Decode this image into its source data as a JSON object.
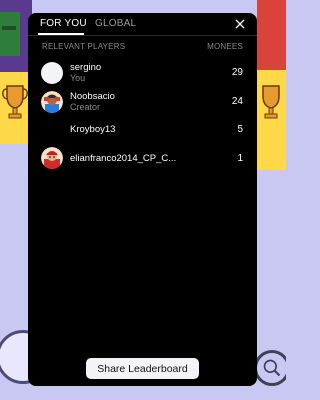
{
  "tabs": [
    {
      "label": "FOR YOU",
      "active": true
    },
    {
      "label": "GLOBAL",
      "active": false
    }
  ],
  "close_icon": "close-icon",
  "columns": {
    "players": "RELEVANT PLAYERS",
    "monees": "MONEES"
  },
  "players": [
    {
      "name": "sergino",
      "subtitle": "You",
      "score": "29",
      "avatar": "blank-avatar"
    },
    {
      "name": "Noobsacio",
      "subtitle": "Creator",
      "score": "24",
      "avatar": "character-avatar"
    },
    {
      "name": "Kroyboy13",
      "subtitle": "",
      "score": "5",
      "avatar": "none"
    },
    {
      "name": "elianfranco2014_CP_C...",
      "subtitle": "",
      "score": "1",
      "avatar": "red-character-avatar"
    }
  ],
  "share_button": "Share Leaderboard",
  "colors": {
    "panel_bg": "#000000",
    "background": "#c9c8f2",
    "muted_text": "#8a8a8a",
    "button_bg": "#f4f4f6"
  }
}
